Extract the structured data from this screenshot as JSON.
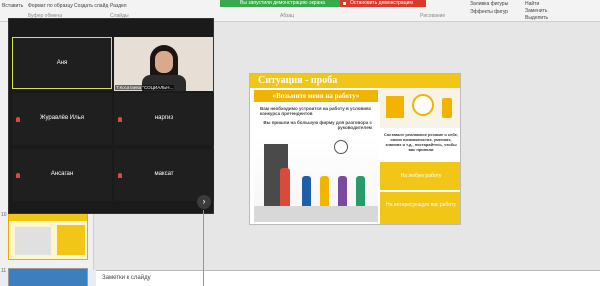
{
  "ribbon": {
    "items": [
      "Вставить",
      "Формат по образцу",
      "Создать слайд",
      "Раздел"
    ],
    "group_labels": [
      "Буфер обмена",
      "Слайды",
      "Абзац",
      "Рисование"
    ],
    "right_items": [
      "Заливка фигуры",
      "Эффекты фигур",
      "Найти",
      "Заменить",
      "Выделить"
    ]
  },
  "share_bar": {
    "status": "Вы запустили демонстрацию экрана",
    "stop_label": "Остановить демонстрацию"
  },
  "zoom": {
    "participants": [
      {
        "name": "Аня",
        "active": true
      },
      {
        "name": "Журавлёв Илья"
      },
      {
        "name": "наргиз"
      },
      {
        "name": "Ансаган"
      },
      {
        "name": "максат"
      }
    ],
    "video_label": "Т.Косатаева \"СОЦИАЛЬН..."
  },
  "slide": {
    "title": "Ситуация - проба",
    "hire": "«Возьмите меня на работу»",
    "text1": "Вам необходимо устроится на работу в условиях конкурса претендентов",
    "text2": "Вы пришли на большую фирму для разговора с руководителем",
    "mid_text": "Составьте рекламное резюме о себе, своих возможностях, умениях, знаниях и т.д., постарайтесь, чтобы вас приняли",
    "box1": "На любую работу",
    "box2": "На интересующую вас работу"
  },
  "notes": {
    "placeholder": "Заметки к слайду"
  },
  "slide_pane": {
    "numbers": [
      "10",
      "11"
    ]
  }
}
